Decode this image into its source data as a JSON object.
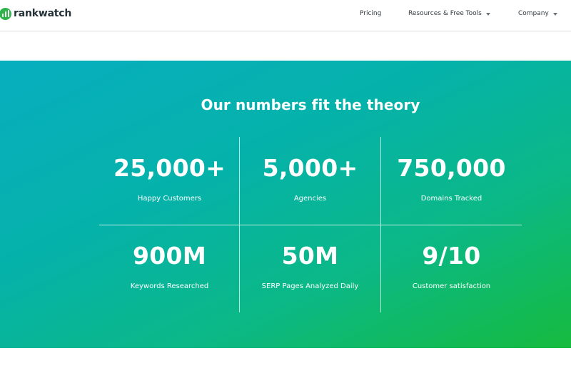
{
  "brand": {
    "name": "rankwatch",
    "color": "#2fb34a"
  },
  "nav": {
    "pricing": "Pricing",
    "resources": "Resources & Free Tools",
    "company": "Company"
  },
  "stats": {
    "title": "Our numbers fit the theory",
    "gradient": [
      "#07aebf",
      "#16bb3e"
    ],
    "items": [
      {
        "value": "25,000+",
        "label": "Happy Customers"
      },
      {
        "value": "5,000+",
        "label": "Agencies"
      },
      {
        "value": "750,000",
        "label": "Domains Tracked"
      },
      {
        "value": "900M",
        "label": "Keywords Researched"
      },
      {
        "value": "50M",
        "label": "SERP Pages Analyzed Daily"
      },
      {
        "value": "9/10",
        "label": "Customer satisfaction"
      }
    ]
  }
}
